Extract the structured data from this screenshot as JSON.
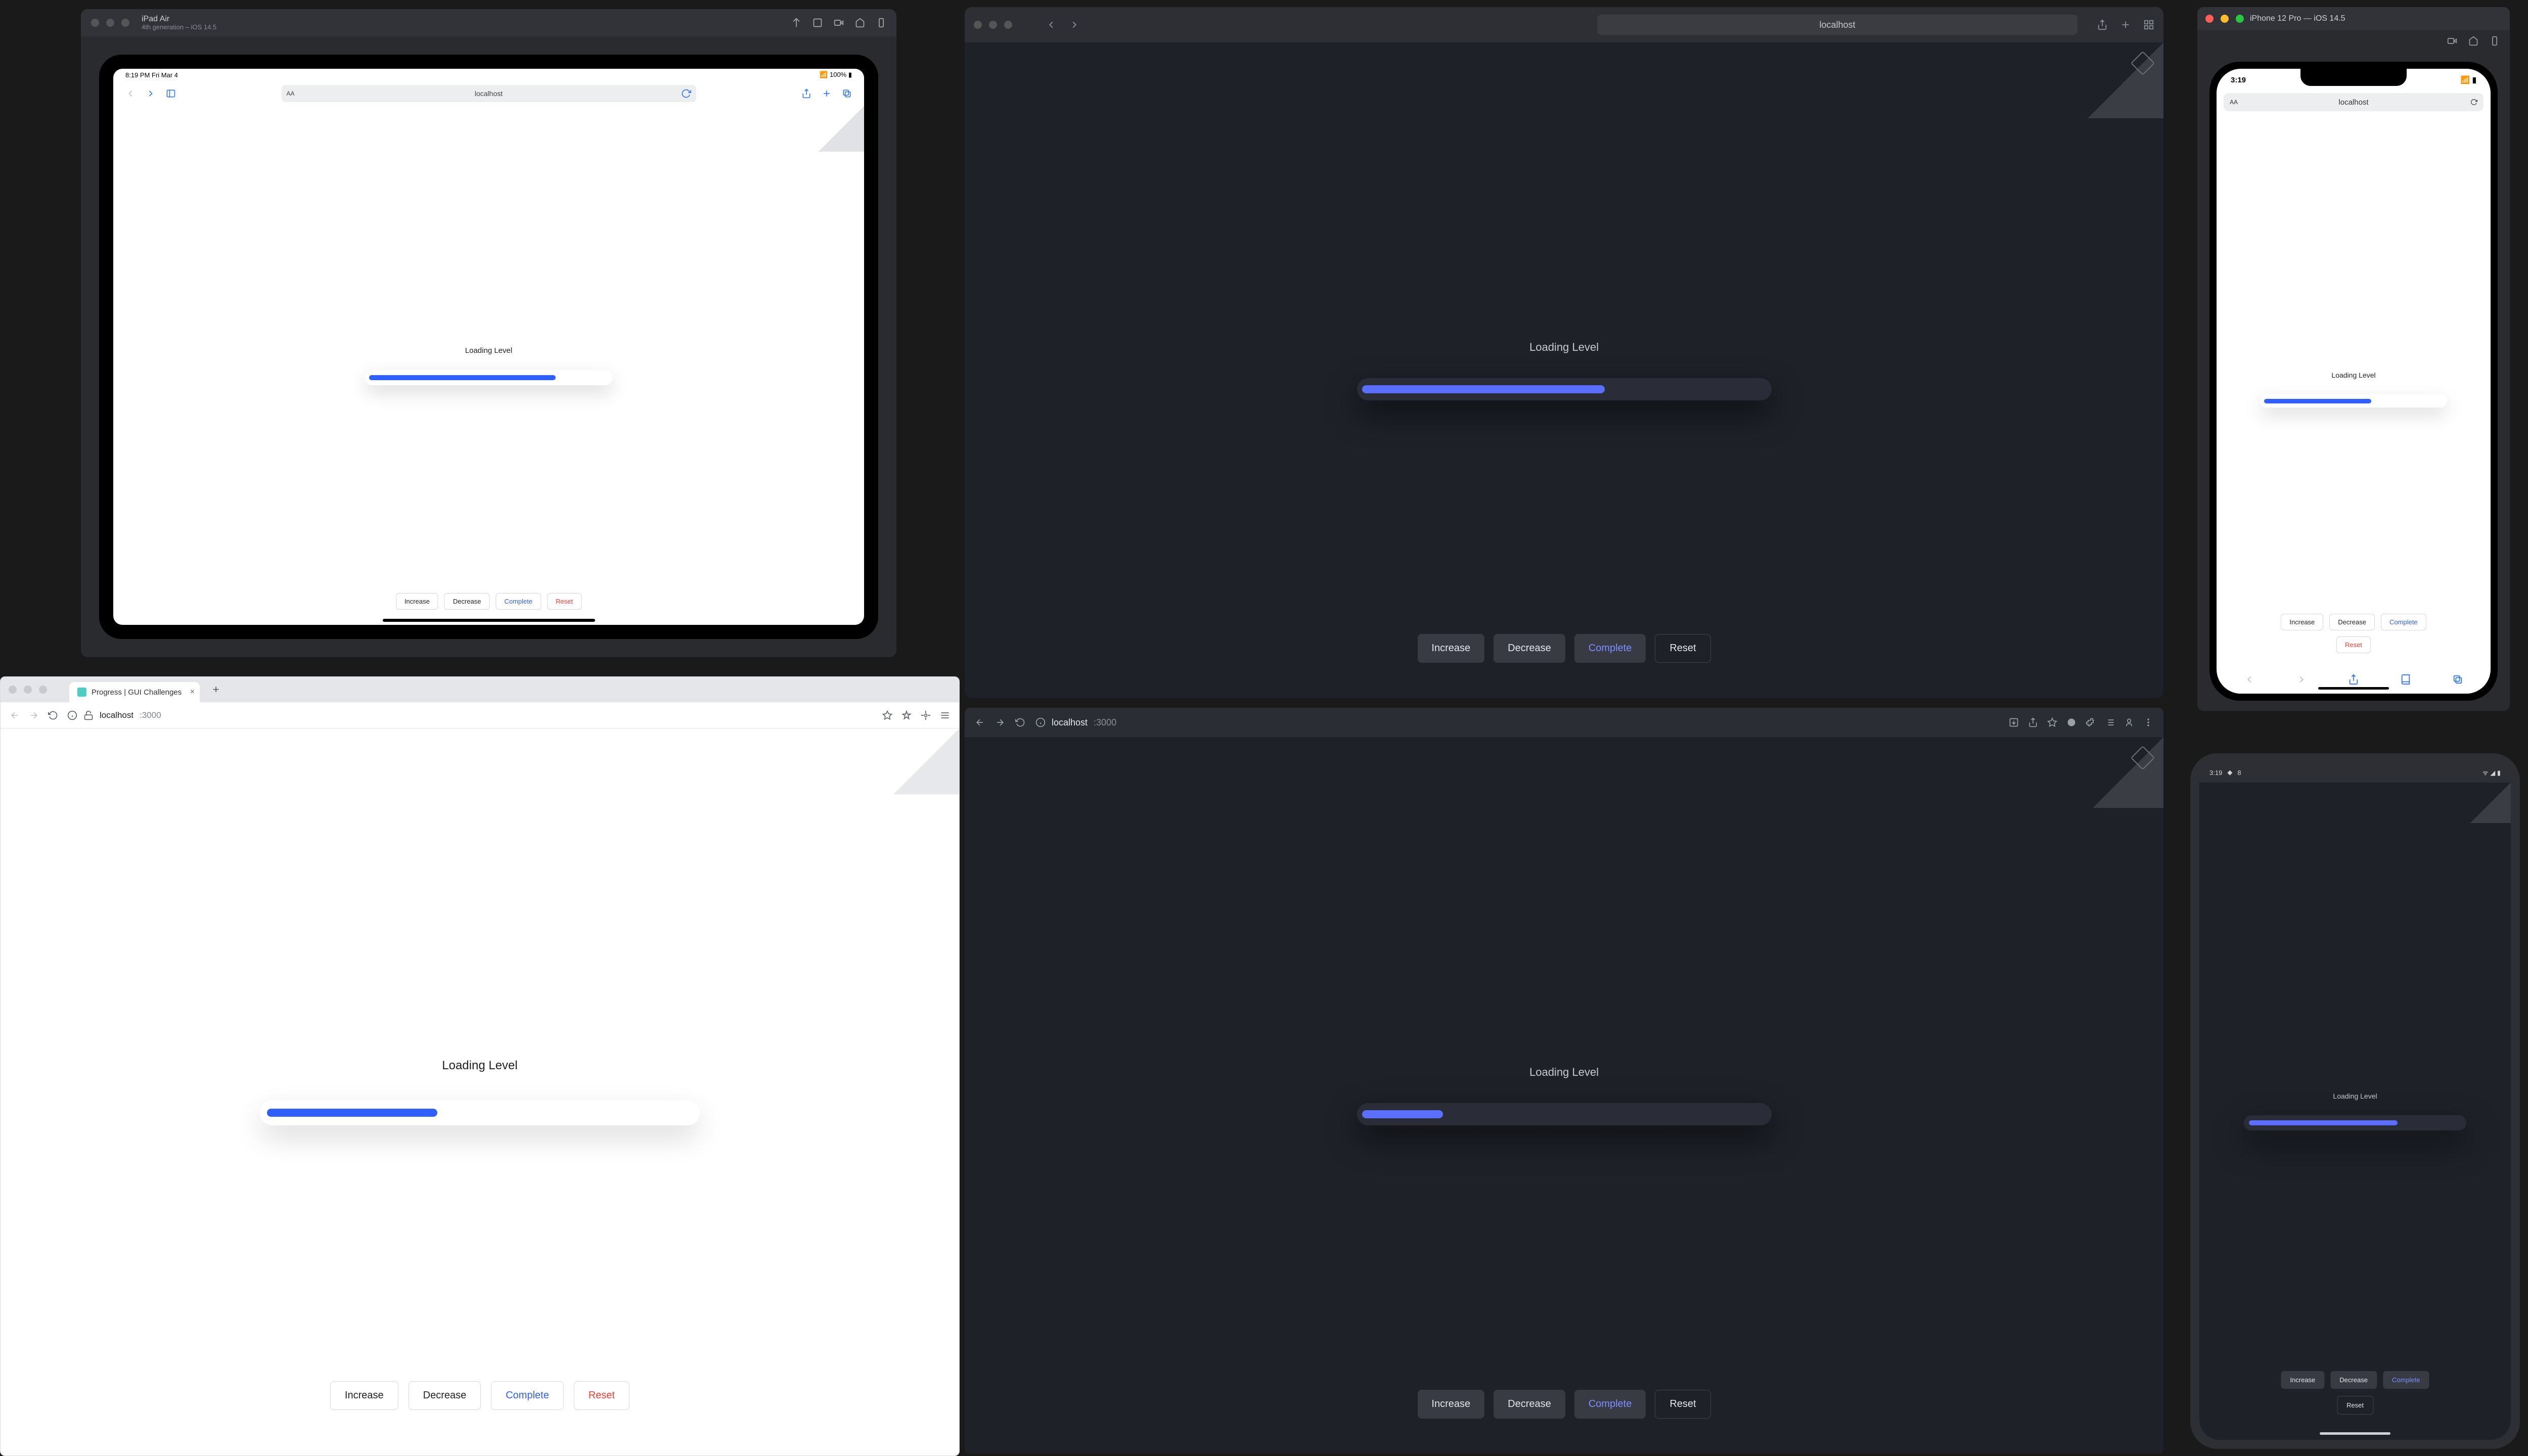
{
  "demo": {
    "label": "Loading Level",
    "buttons": {
      "increase": "Increase",
      "decrease": "Decrease",
      "complete": "Complete",
      "reset": "Reset"
    }
  },
  "safari": {
    "url": "localhost",
    "progress_pct": 60
  },
  "ipad": {
    "win_title": "iPad Air",
    "win_subtitle": "4th generation – iOS 14.5",
    "status_time": "8:19 PM  Fri Mar 4",
    "status_right": "100%",
    "url": "localhost",
    "progress_pct": 78
  },
  "chrome_light": {
    "tab_title": "Progress | GUI Challenges",
    "url_domain": "localhost",
    "url_path": ":3000",
    "progress_pct": 40
  },
  "chrome_dark": {
    "url_domain": "localhost",
    "url_path": ":3000",
    "progress_pct": 20
  },
  "iphone": {
    "win_title": "iPhone 12 Pro — iOS 14.5",
    "status_time": "3:19",
    "url": "localhost",
    "progress_pct": 60
  },
  "android": {
    "status_time": "3:19",
    "status_icon": "8",
    "progress_pct": 70
  },
  "colors": {
    "accent_light": "#2f5fff",
    "accent_dark": "#5b6fff",
    "danger": "#ff3b30"
  }
}
